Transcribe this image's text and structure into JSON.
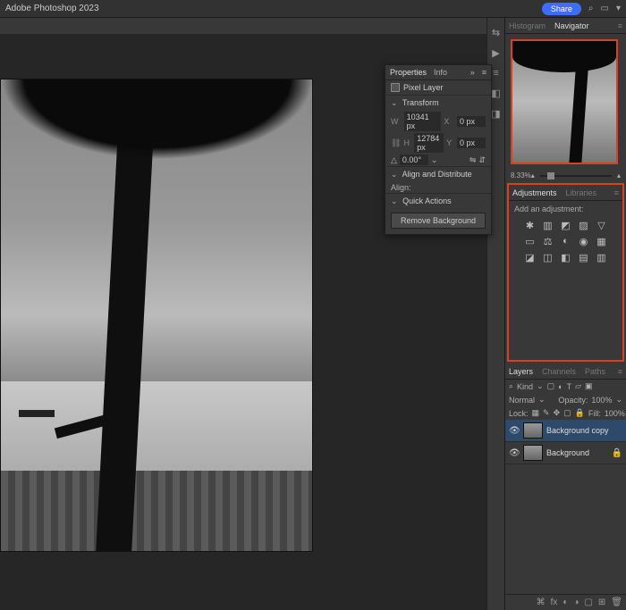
{
  "app": {
    "title": "Adobe Photoshop 2023",
    "share": "Share"
  },
  "nav": {
    "tabs": [
      "Histogram",
      "Navigator"
    ],
    "active": 1,
    "zoom": "8.33%"
  },
  "adj": {
    "tabs": [
      "Adjustments",
      "Libraries"
    ],
    "active": 0,
    "label": "Add an adjustment:"
  },
  "layers": {
    "tabs": [
      "Layers",
      "Channels",
      "Paths"
    ],
    "active": 0,
    "kind": "Kind",
    "blend": "Normal",
    "opacityLabel": "Opacity:",
    "opacity": "100%",
    "lockLabel": "Lock:",
    "fillLabel": "Fill:",
    "fill": "100%",
    "items": [
      {
        "name": "Background copy",
        "selected": true,
        "locked": false
      },
      {
        "name": "Background",
        "selected": false,
        "locked": true
      }
    ]
  },
  "props": {
    "tabs": [
      "Properties",
      "Info"
    ],
    "active": 0,
    "layerType": "Pixel Layer",
    "transform": "Transform",
    "w": "10341 px",
    "h": "12784 px",
    "x": "0 px",
    "y": "0 px",
    "angle": "0.00°",
    "align": "Align and Distribute",
    "alignLabel": "Align:",
    "quick": "Quick Actions",
    "removeBg": "Remove Background"
  }
}
